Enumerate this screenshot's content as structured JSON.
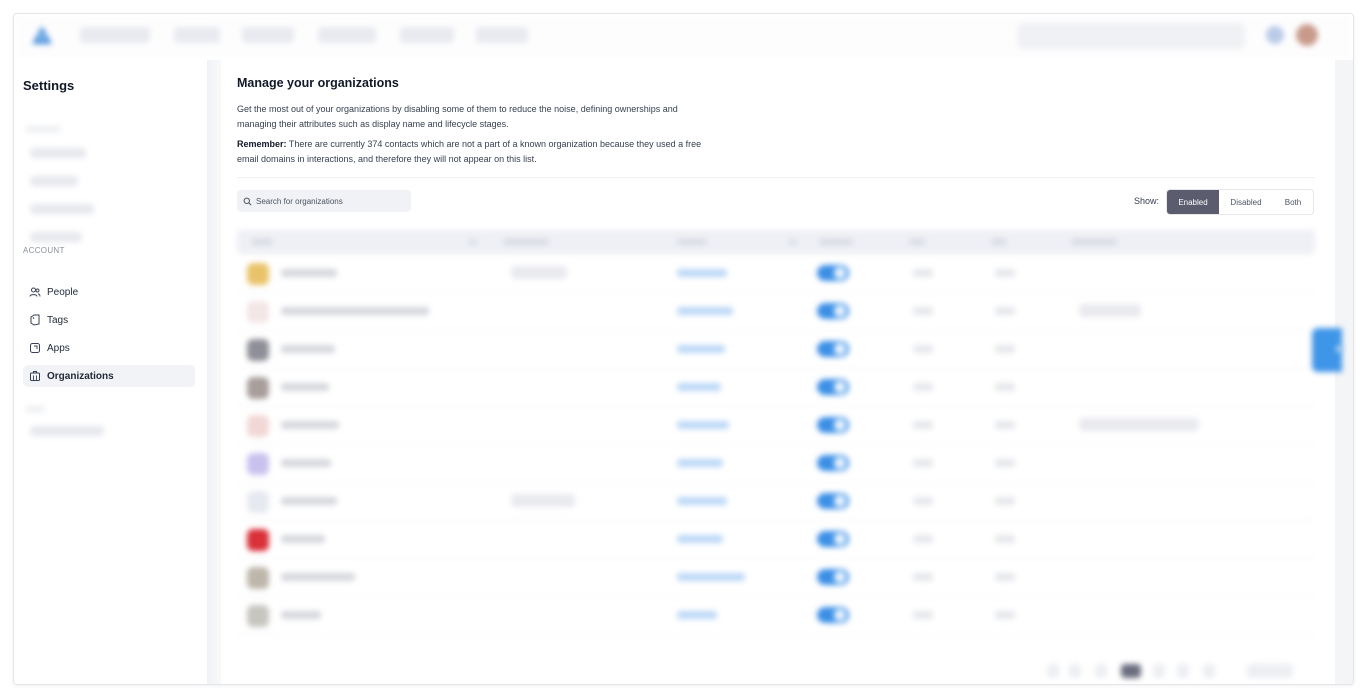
{
  "sidebar": {
    "title": "Settings",
    "account_section_label": "ACCOUNT",
    "items": [
      {
        "label": "People",
        "icon": "people-icon"
      },
      {
        "label": "Tags",
        "icon": "tag-icon"
      },
      {
        "label": "Apps",
        "icon": "apps-icon"
      },
      {
        "label": "Organizations",
        "icon": "building-icon",
        "active": true
      }
    ]
  },
  "main": {
    "title": "Manage your organizations",
    "description": "Get the most out of your organizations by disabling some of them to reduce the noise, defining ownerships and managing their attributes such as display name and lifecycle stages.",
    "remember_label": "Remember:",
    "remember_text": " There are currently 374 contacts which are not a part of a known organization because they used a free email domains in interactions, and therefore they will not appear on this list.",
    "search": {
      "placeholder": "Search for organizations",
      "value": "",
      "icon": "search-icon"
    },
    "show_filter": {
      "label": "Show:",
      "options": [
        "Enabled",
        "Disabled",
        "Both"
      ],
      "selected": "Enabled"
    },
    "table": {
      "rows_count": 10,
      "row_toggles_enabled": [
        true,
        true,
        true,
        true,
        true,
        true,
        true,
        true,
        true,
        true
      ]
    }
  },
  "colors": {
    "accent": "#3b8fe6",
    "selected_segment": "#5b5d6e",
    "active_sidebar_bg": "#f2f3f6"
  }
}
